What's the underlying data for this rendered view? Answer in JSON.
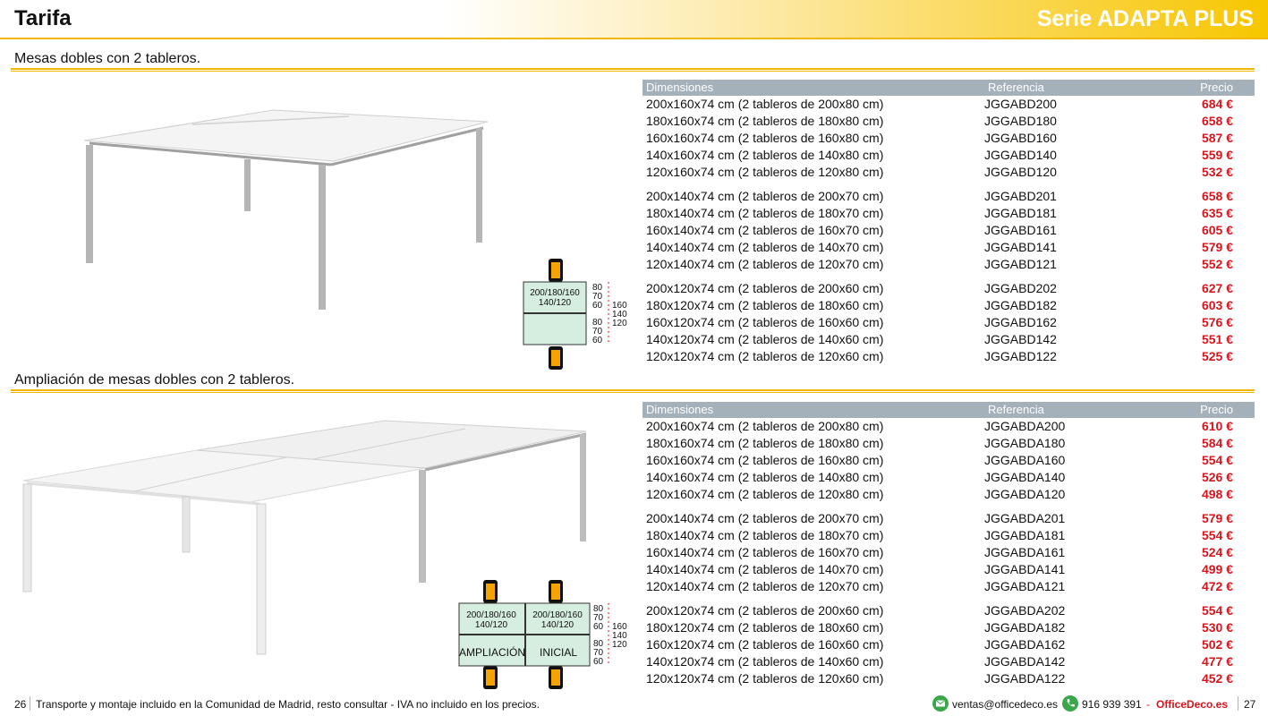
{
  "header": {
    "title": "Tarifa",
    "series": "Serie ADAPTA PLUS"
  },
  "section1": {
    "title": "Mesas dobles con 2 tableros.",
    "table": {
      "headers": [
        "Dimensiones",
        "Referencia",
        "Precio"
      ],
      "groups": [
        [
          [
            "200x160x74 cm (2 tableros de 200x80 cm)",
            "JGGABD200",
            "684 €"
          ],
          [
            "180x160x74 cm (2 tableros de 180x80 cm)",
            "JGGABD180",
            "658 €"
          ],
          [
            "160x160x74 cm (2 tableros de 160x80 cm)",
            "JGGABD160",
            "587 €"
          ],
          [
            "140x160x74 cm (2 tableros de 140x80 cm)",
            "JGGABD140",
            "559 €"
          ],
          [
            "120x160x74 cm (2 tableros de 120x80 cm)",
            "JGGABD120",
            "532 €"
          ]
        ],
        [
          [
            "200x140x74 cm (2 tableros de 200x70 cm)",
            "JGGABD201",
            "658 €"
          ],
          [
            "180x140x74 cm (2 tableros de 180x70 cm)",
            "JGGABD181",
            "635 €"
          ],
          [
            "160x140x74 cm (2 tableros de 160x70 cm)",
            "JGGABD161",
            "605 €"
          ],
          [
            "140x140x74 cm (2 tableros de 140x70 cm)",
            "JGGABD141",
            "579 €"
          ],
          [
            "120x140x74 cm (2 tableros de 120x70 cm)",
            "JGGABD121",
            "552 €"
          ]
        ],
        [
          [
            "200x120x74 cm (2 tableros de 200x60 cm)",
            "JGGABD202",
            "627 €"
          ],
          [
            "180x120x74 cm (2 tableros de 180x60 cm)",
            "JGGABD182",
            "603 €"
          ],
          [
            "160x120x74 cm (2 tableros de 160x60 cm)",
            "JGGABD162",
            "576 €"
          ],
          [
            "140x120x74 cm (2 tableros de 140x60 cm)",
            "JGGABD142",
            "551 €"
          ],
          [
            "120x120x74 cm (2 tableros de 120x60 cm)",
            "JGGABD122",
            "525 €"
          ]
        ]
      ]
    },
    "scheme": {
      "board_label_1": "200/180/160",
      "board_label_2": "140/120",
      "depths_top": [
        "80",
        "70",
        "60"
      ],
      "depths_total": [
        "160",
        "140",
        "120"
      ],
      "depths_bottom": [
        "80",
        "70",
        "60"
      ]
    }
  },
  "section2": {
    "title": "Ampliación de mesas dobles con 2 tableros.",
    "table": {
      "headers": [
        "Dimensiones",
        "Referencia",
        "Precio"
      ],
      "groups": [
        [
          [
            "200x160x74 cm (2 tableros de 200x80 cm)",
            "JGGABDA200",
            "610 €"
          ],
          [
            "180x160x74 cm (2 tableros de 180x80 cm)",
            "JGGABDA180",
            "584 €"
          ],
          [
            "160x160x74 cm (2 tableros de 160x80 cm)",
            "JGGABDA160",
            "554 €"
          ],
          [
            "140x160x74 cm (2 tableros de 140x80 cm)",
            "JGGABDA140",
            "526 €"
          ],
          [
            "120x160x74 cm (2 tableros de 120x80 cm)",
            "JGGABDA120",
            "498 €"
          ]
        ],
        [
          [
            "200x140x74 cm (2 tableros de 200x70 cm)",
            "JGGABDA201",
            "579 €"
          ],
          [
            "180x140x74 cm (2 tableros de 180x70 cm)",
            "JGGABDA181",
            "554 €"
          ],
          [
            "160x140x74 cm (2 tableros de 160x70 cm)",
            "JGGABDA161",
            "524 €"
          ],
          [
            "140x140x74 cm (2 tableros de 140x70 cm)",
            "JGGABDA141",
            "499 €"
          ],
          [
            "120x140x74 cm (2 tableros de 120x70 cm)",
            "JGGABDA121",
            "472 €"
          ]
        ],
        [
          [
            "200x120x74 cm (2 tableros de 200x60 cm)",
            "JGGABDA202",
            "554 €"
          ],
          [
            "180x120x74 cm (2 tableros de 180x60 cm)",
            "JGGABDA182",
            "530 €"
          ],
          [
            "160x120x74 cm (2 tableros de 160x60 cm)",
            "JGGABDA162",
            "502 €"
          ],
          [
            "140x120x74 cm (2 tableros de 140x60 cm)",
            "JGGABDA142",
            "477 €"
          ],
          [
            "120x120x74 cm (2 tableros de 120x60 cm)",
            "JGGABDA122",
            "452 €"
          ]
        ]
      ]
    },
    "scheme": {
      "board_label_1": "200/180/160",
      "board_label_2": "140/120",
      "extension_label": "AMPLIACIÓN",
      "initial_label": "INICIAL",
      "depths_top": [
        "80",
        "70",
        "60"
      ],
      "depths_total": [
        "160",
        "140",
        "120"
      ],
      "depths_bottom": [
        "80",
        "70",
        "60"
      ]
    }
  },
  "footer": {
    "page_left": "26",
    "note": "Transporte y montaje incluido en la Comunidad de Madrid, resto consultar - IVA no incluido en los precios.",
    "email": "ventas@officedeco.es",
    "phone": "916 939 391",
    "brand": "OfficeDeco.es",
    "page_right": "27"
  },
  "colors": {
    "accent": "#f2b700",
    "price": "#d9141c",
    "table_header": "#a5b1ba",
    "scheme_fill": "#d5eee0",
    "chair": "#f5a300"
  }
}
